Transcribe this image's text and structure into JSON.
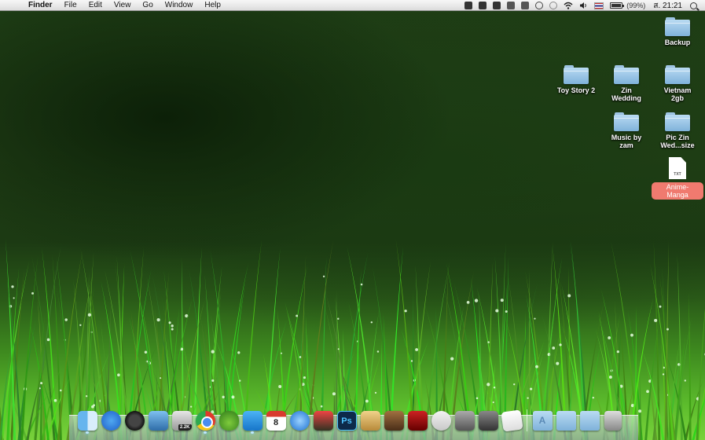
{
  "menubar": {
    "apple_glyph": "",
    "app_name": "Finder",
    "menus": [
      "File",
      "Edit",
      "View",
      "Go",
      "Window",
      "Help"
    ],
    "status_icons": [
      "evernote-icon",
      "skype-icon",
      "dropbox-icon",
      "window-icon",
      "copy-icon",
      "sync-icon",
      "time-machine-icon",
      "wifi-icon",
      "volume-icon",
      "thai-flag-icon"
    ],
    "battery": {
      "percent": 0.99,
      "text": "(99%)"
    },
    "clock": "ส. 21:21"
  },
  "desktop": {
    "items": [
      {
        "name": "Backup",
        "type": "folder"
      },
      {
        "name": "Toy Story 2",
        "type": "folder"
      },
      {
        "name": "Zin Wedding",
        "type": "folder"
      },
      {
        "name": "Vietnam 2gb",
        "type": "folder"
      },
      {
        "name": "Music by zam",
        "type": "folder"
      },
      {
        "name": "Pic Zin Wed...size",
        "type": "folder"
      },
      {
        "name": "Anime-Manga",
        "type": "document",
        "doc_type": "TXT",
        "label_color": "#f07a6f"
      }
    ]
  },
  "dock": {
    "apps": [
      {
        "icon": "finder-icon",
        "running": true
      },
      {
        "icon": "app-store-icon",
        "running": false
      },
      {
        "icon": "dashboard-icon",
        "running": false
      },
      {
        "icon": "preview-icon",
        "running": false
      },
      {
        "icon": "growl-icon",
        "running": false,
        "badge": "2.2K"
      },
      {
        "icon": "chrome-icon",
        "running": true
      },
      {
        "icon": "frog-icon",
        "running": false
      },
      {
        "icon": "twitter-icon",
        "running": true
      },
      {
        "icon": "calendar-icon",
        "running": false,
        "text": "8"
      },
      {
        "icon": "itunes-icon",
        "running": false
      },
      {
        "icon": "game-icon",
        "running": false
      },
      {
        "icon": "photoshop-icon",
        "running": false,
        "text": "Ps"
      },
      {
        "icon": "mail-icon",
        "running": false
      },
      {
        "icon": "iphoto-icon",
        "running": false
      },
      {
        "icon": "photo-booth-icon",
        "running": false
      },
      {
        "icon": "xcode-icon",
        "running": false
      },
      {
        "icon": "disk-utility-icon",
        "running": false
      },
      {
        "icon": "vlc-icon",
        "running": false
      },
      {
        "icon": "textedit-icon",
        "running": false
      }
    ],
    "stacks": [
      {
        "icon": "applications-folder-icon",
        "glyph": "A"
      },
      {
        "icon": "documents-folder-icon",
        "glyph": ""
      },
      {
        "icon": "downloads-folder-icon",
        "glyph": ""
      }
    ],
    "trash": {
      "icon": "trash-icon"
    }
  },
  "colors": {
    "menubar": "#e8e8e8",
    "label_red": "#f07a6f",
    "folder": "#8fc0e6"
  }
}
